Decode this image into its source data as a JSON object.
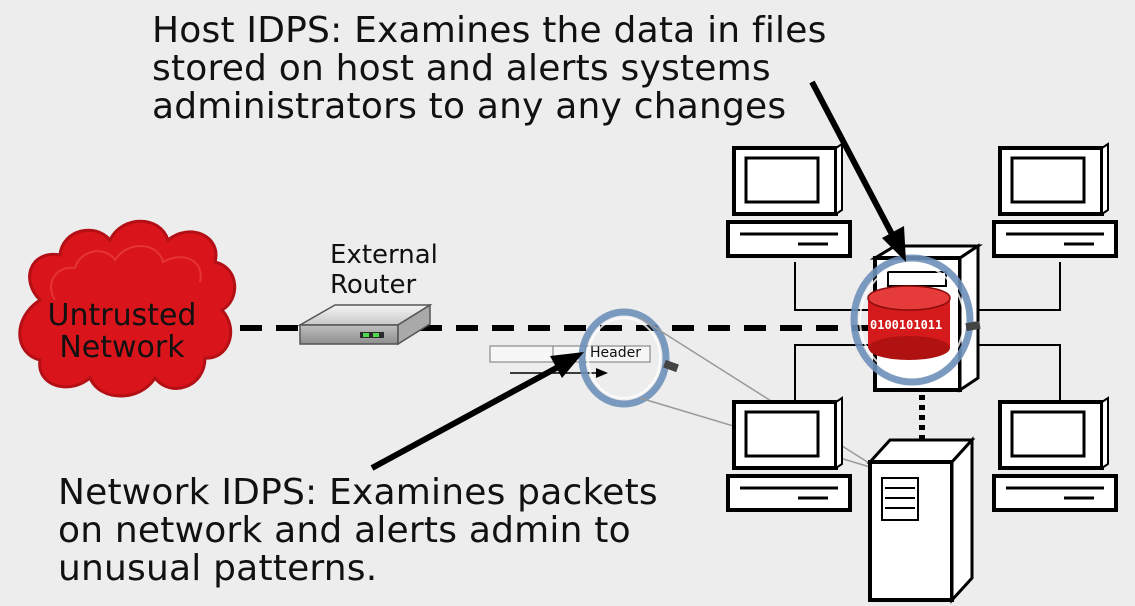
{
  "host_idps": {
    "lines": [
      "Host IDPS:  Examines the data in files",
      "stored on host and alerts systems",
      "administrators to any any changes"
    ]
  },
  "network_idps": {
    "lines": [
      "Network IDPS: Examines packets",
      "on network and alerts admin to",
      "unusual patterns."
    ]
  },
  "router": {
    "lines": [
      "External",
      "Router"
    ]
  },
  "cloud": {
    "lines": [
      "Untrusted",
      "Network"
    ]
  },
  "packet": {
    "header_label": "Header"
  },
  "disk": {
    "bits_label": "0100101011"
  },
  "colors": {
    "cloud": "#d9141b",
    "disk": "#d41a1a",
    "lens": "#6d8fb8",
    "background": "#ededed"
  }
}
